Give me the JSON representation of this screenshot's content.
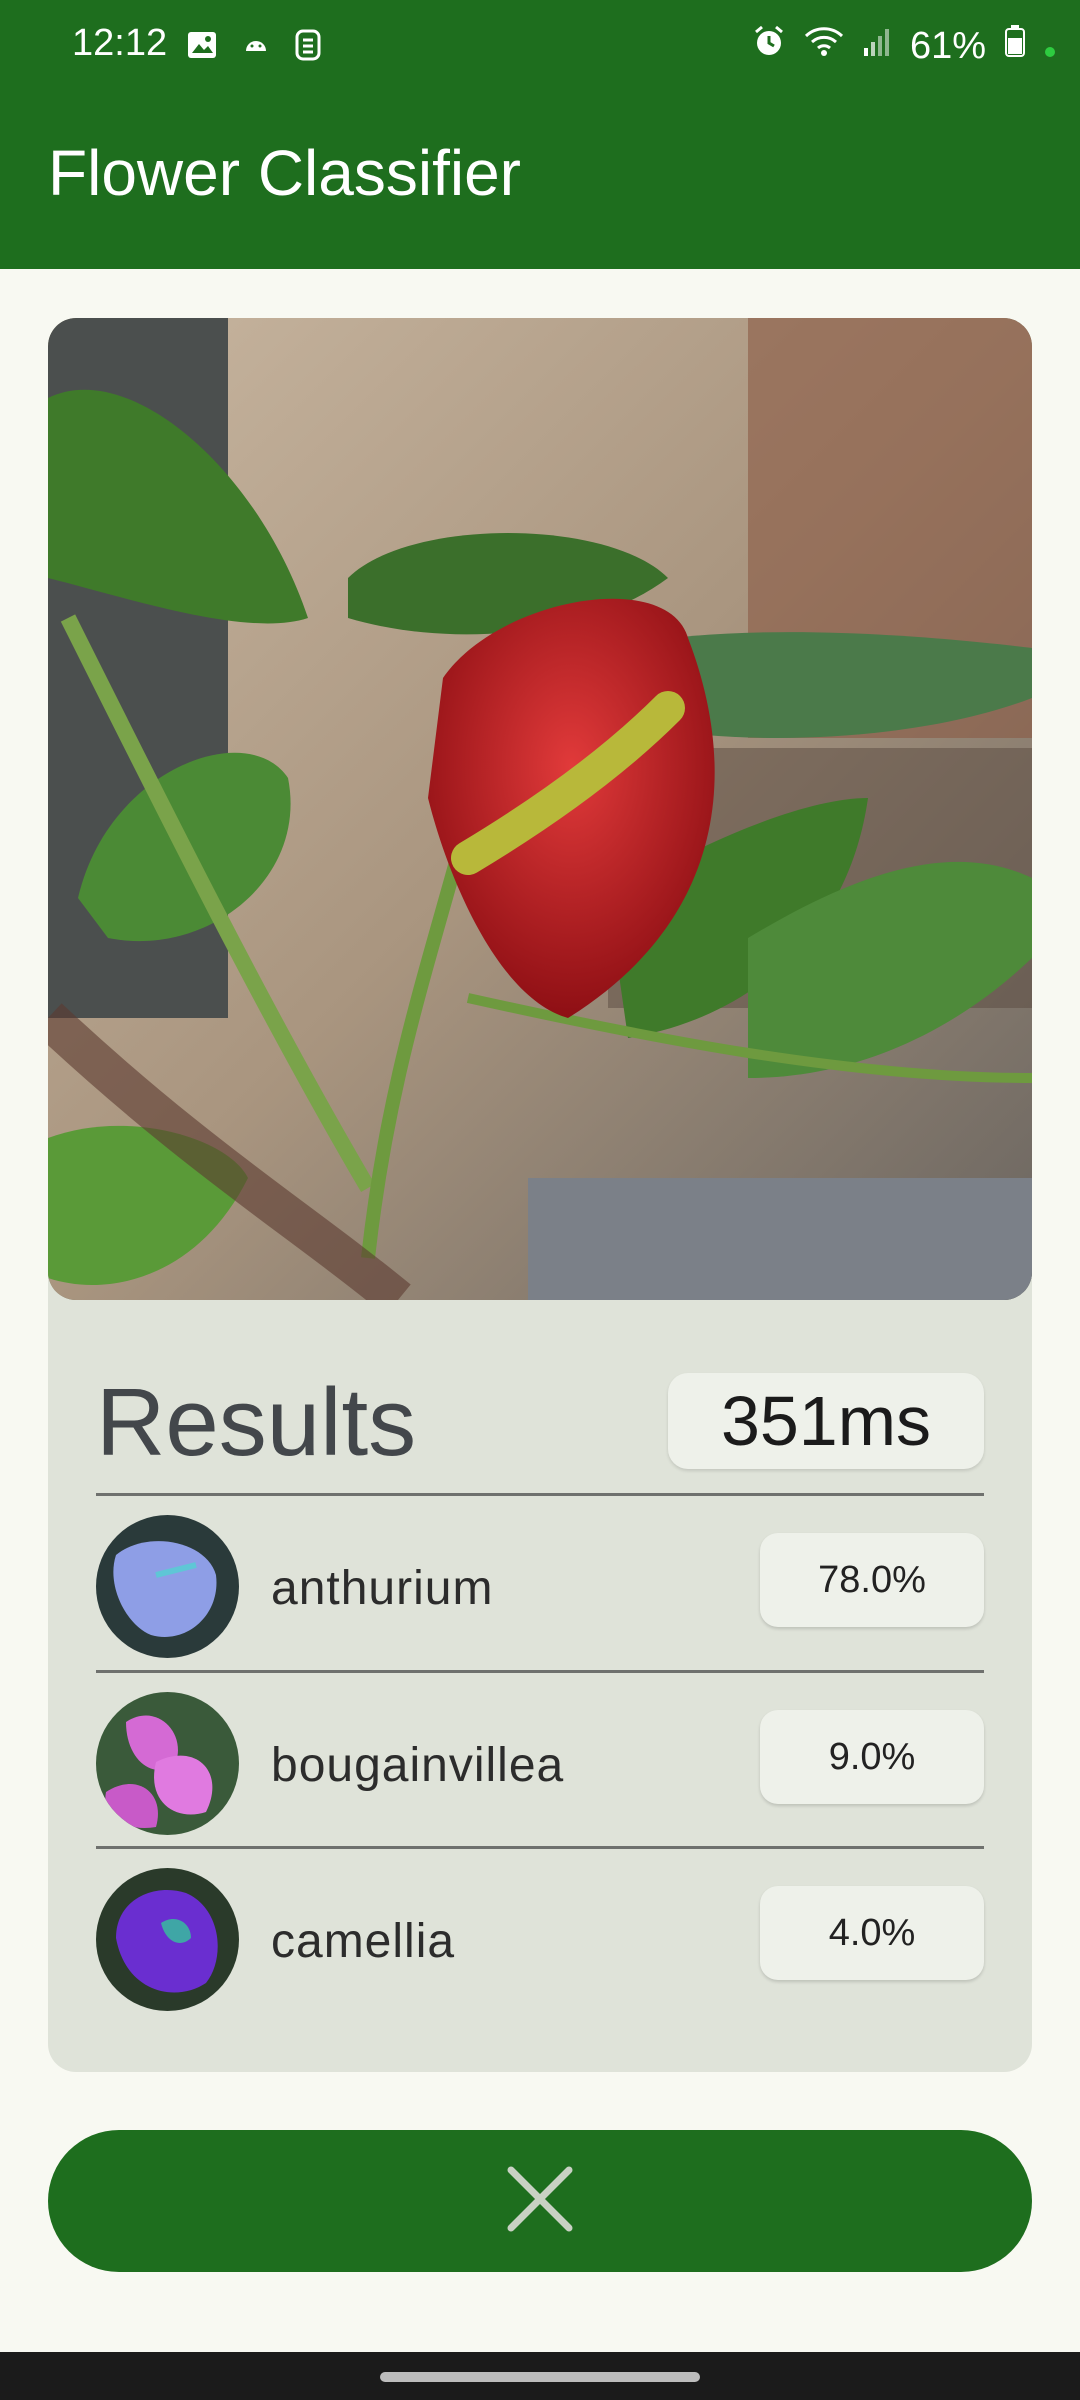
{
  "status_bar": {
    "time": "12:12",
    "battery_percent": "61%",
    "left_icons": [
      "image-icon",
      "android-icon",
      "sim-icon"
    ],
    "right_icons": [
      "alarm-icon",
      "wifi-icon",
      "signal-icon",
      "battery-icon"
    ]
  },
  "app_bar": {
    "title": "Flower Classifier"
  },
  "photo": {
    "subject": "flower-photo"
  },
  "results": {
    "title": "Results",
    "inference_time": "351ms",
    "items": [
      {
        "label": "anthurium",
        "score": "78.0%",
        "thumb": "anthurium-thumbnail"
      },
      {
        "label": "bougainvillea",
        "score": "9.0%",
        "thumb": "bougainvillea-thumbnail"
      },
      {
        "label": "camellia",
        "score": "4.0%",
        "thumb": "camellia-thumbnail"
      }
    ]
  },
  "close_button": {
    "icon": "close-icon"
  },
  "colors": {
    "primary": "#1E6E1E",
    "card_bg": "#DFE3D9",
    "page_bg": "#F8F9F2",
    "badge_bg": "#EEF1EA"
  }
}
